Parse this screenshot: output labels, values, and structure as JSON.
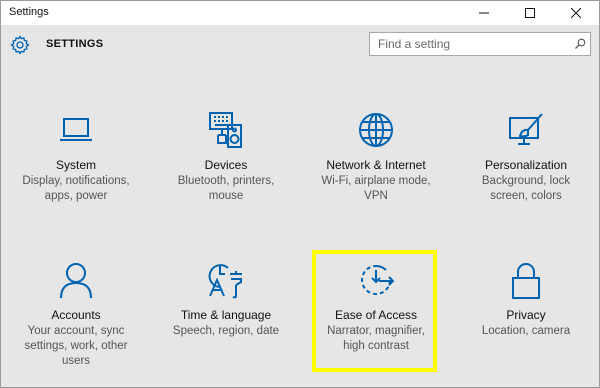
{
  "window": {
    "title": "Settings",
    "minimize_icon": "minimize-icon",
    "maximize_icon": "maximize-icon",
    "close_icon": "close-icon"
  },
  "header": {
    "title": "SETTINGS",
    "icon": "gear-icon",
    "search_placeholder": "Find a setting",
    "search_icon": "search-icon"
  },
  "colors": {
    "accent": "#0063b1",
    "highlight": "#ffff00",
    "background": "#e6e6e6"
  },
  "tiles": [
    {
      "name": "System",
      "desc1": "Display, notifications,",
      "desc2": "apps, power",
      "desc3": "",
      "icon": "laptop-icon"
    },
    {
      "name": "Devices",
      "desc1": "Bluetooth, printers,",
      "desc2": "mouse",
      "desc3": "",
      "icon": "devices-icon"
    },
    {
      "name": "Network & Internet",
      "desc1": "Wi-Fi, airplane mode,",
      "desc2": "VPN",
      "desc3": "",
      "icon": "globe-icon"
    },
    {
      "name": "Personalization",
      "desc1": "Background, lock",
      "desc2": "screen, colors",
      "desc3": "",
      "icon": "personalization-icon"
    },
    {
      "name": "Accounts",
      "desc1": "Your account, sync",
      "desc2": "settings, work, other",
      "desc3": "users",
      "icon": "person-icon"
    },
    {
      "name": "Time & language",
      "desc1": "Speech, region, date",
      "desc2": "",
      "desc3": "",
      "icon": "time-language-icon"
    },
    {
      "name": "Ease of Access",
      "desc1": "Narrator, magnifier,",
      "desc2": "high contrast",
      "desc3": "",
      "icon": "ease-of-access-icon"
    },
    {
      "name": "Privacy",
      "desc1": "Location, camera",
      "desc2": "",
      "desc3": "",
      "icon": "lock-icon"
    }
  ]
}
